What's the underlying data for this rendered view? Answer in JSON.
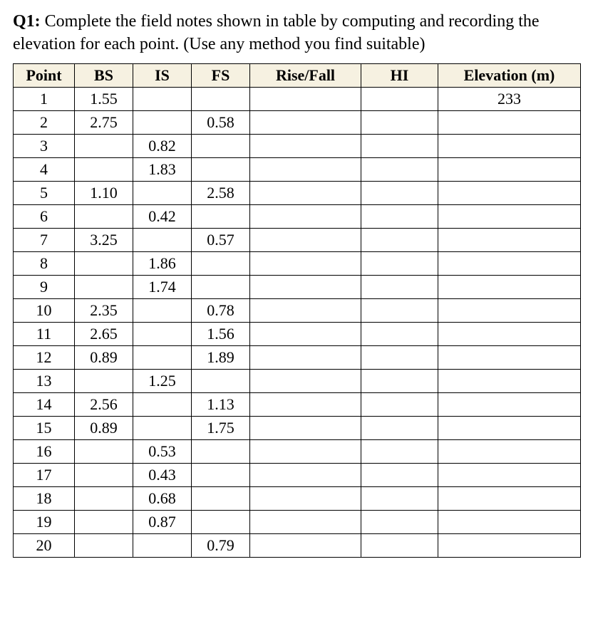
{
  "question": {
    "label": "Q1:",
    "text": " Complete the field notes shown in table by computing and recording the elevation for each point. (Use any method you find suitable)"
  },
  "headers": {
    "point": "Point",
    "bs": "BS",
    "is": "IS",
    "fs": "FS",
    "rise_fall": "Rise/Fall",
    "hi": "HI",
    "elevation": "Elevation (m)"
  },
  "chart_data": {
    "type": "table",
    "title": "Levelling field notes",
    "columns": [
      "Point",
      "BS",
      "IS",
      "FS",
      "Rise/Fall",
      "HI",
      "Elevation (m)"
    ],
    "rows": [
      {
        "point": "1",
        "bs": "1.55",
        "is": "",
        "fs": "",
        "rise_fall": "",
        "hi": "",
        "elevation": "233"
      },
      {
        "point": "2",
        "bs": "2.75",
        "is": "",
        "fs": "0.58",
        "rise_fall": "",
        "hi": "",
        "elevation": ""
      },
      {
        "point": "3",
        "bs": "",
        "is": "0.82",
        "fs": "",
        "rise_fall": "",
        "hi": "",
        "elevation": ""
      },
      {
        "point": "4",
        "bs": "",
        "is": "1.83",
        "fs": "",
        "rise_fall": "",
        "hi": "",
        "elevation": ""
      },
      {
        "point": "5",
        "bs": "1.10",
        "is": "",
        "fs": "2.58",
        "rise_fall": "",
        "hi": "",
        "elevation": ""
      },
      {
        "point": "6",
        "bs": "",
        "is": "0.42",
        "fs": "",
        "rise_fall": "",
        "hi": "",
        "elevation": ""
      },
      {
        "point": "7",
        "bs": "3.25",
        "is": "",
        "fs": "0.57",
        "rise_fall": "",
        "hi": "",
        "elevation": ""
      },
      {
        "point": "8",
        "bs": "",
        "is": "1.86",
        "fs": "",
        "rise_fall": "",
        "hi": "",
        "elevation": ""
      },
      {
        "point": "9",
        "bs": "",
        "is": "1.74",
        "fs": "",
        "rise_fall": "",
        "hi": "",
        "elevation": ""
      },
      {
        "point": "10",
        "bs": "2.35",
        "is": "",
        "fs": "0.78",
        "rise_fall": "",
        "hi": "",
        "elevation": ""
      },
      {
        "point": "11",
        "bs": "2.65",
        "is": "",
        "fs": "1.56",
        "rise_fall": "",
        "hi": "",
        "elevation": ""
      },
      {
        "point": "12",
        "bs": "0.89",
        "is": "",
        "fs": "1.89",
        "rise_fall": "",
        "hi": "",
        "elevation": ""
      },
      {
        "point": "13",
        "bs": "",
        "is": "1.25",
        "fs": "",
        "rise_fall": "",
        "hi": "",
        "elevation": ""
      },
      {
        "point": "14",
        "bs": "2.56",
        "is": "",
        "fs": "1.13",
        "rise_fall": "",
        "hi": "",
        "elevation": ""
      },
      {
        "point": "15",
        "bs": "0.89",
        "is": "",
        "fs": "1.75",
        "rise_fall": "",
        "hi": "",
        "elevation": ""
      },
      {
        "point": "16",
        "bs": "",
        "is": "0.53",
        "fs": "",
        "rise_fall": "",
        "hi": "",
        "elevation": ""
      },
      {
        "point": "17",
        "bs": "",
        "is": "0.43",
        "fs": "",
        "rise_fall": "",
        "hi": "",
        "elevation": ""
      },
      {
        "point": "18",
        "bs": "",
        "is": "0.68",
        "fs": "",
        "rise_fall": "",
        "hi": "",
        "elevation": ""
      },
      {
        "point": "19",
        "bs": "",
        "is": "0.87",
        "fs": "",
        "rise_fall": "",
        "hi": "",
        "elevation": ""
      },
      {
        "point": "20",
        "bs": "",
        "is": "",
        "fs": "0.79",
        "rise_fall": "",
        "hi": "",
        "elevation": ""
      }
    ]
  }
}
